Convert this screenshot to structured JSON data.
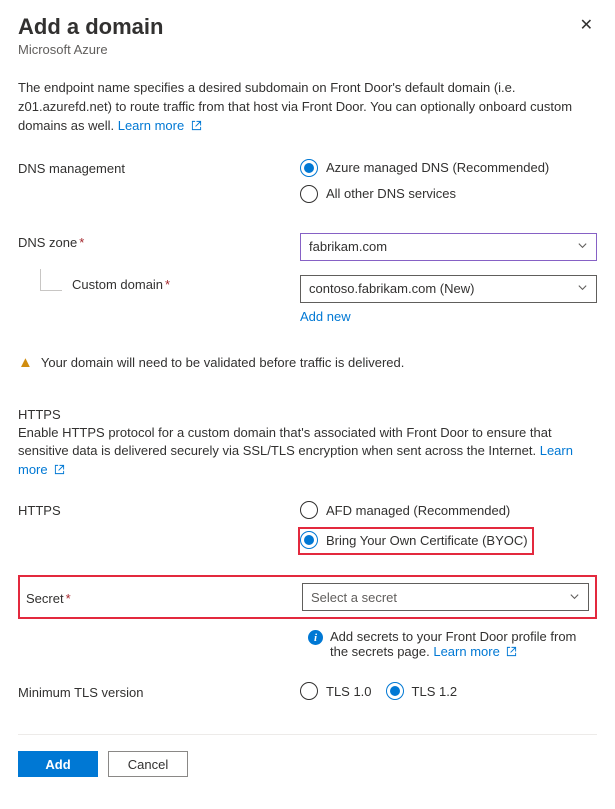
{
  "header": {
    "title": "Add a domain",
    "subtitle": "Microsoft Azure"
  },
  "intro": {
    "text": "The endpoint name specifies a desired subdomain on Front Door's default domain (i.e. z01.azurefd.net) to route traffic from that host via Front Door. You can optionally onboard custom domains as well. ",
    "learn_more": "Learn more"
  },
  "dns_mgmt": {
    "label": "DNS management",
    "options": {
      "azure": "Azure managed DNS (Recommended)",
      "other": "All other DNS services"
    }
  },
  "dns_zone": {
    "label": "DNS zone",
    "value": "fabrikam.com"
  },
  "custom_domain": {
    "label": "Custom domain",
    "value": "contoso.fabrikam.com (New)",
    "add_new": "Add new"
  },
  "warning": "Your domain will need to be validated before traffic is delivered.",
  "https_section": {
    "title": "HTTPS",
    "desc": "Enable HTTPS protocol for a custom domain that's associated with Front Door to ensure that sensitive data is delivered securely via SSL/TLS encryption when sent across the Internet. ",
    "learn_more": "Learn more"
  },
  "https_opts": {
    "label": "HTTPS",
    "afd": "AFD managed (Recommended)",
    "byoc": "Bring Your Own Certificate (BYOC)"
  },
  "secret": {
    "label": "Secret",
    "placeholder": "Select a secret",
    "info_text": "Add secrets to your Front Door profile from the secrets page. ",
    "learn_more": "Learn more"
  },
  "tls": {
    "label": "Minimum TLS version",
    "v10": "TLS 1.0",
    "v12": "TLS 1.2"
  },
  "footer": {
    "add": "Add",
    "cancel": "Cancel"
  }
}
